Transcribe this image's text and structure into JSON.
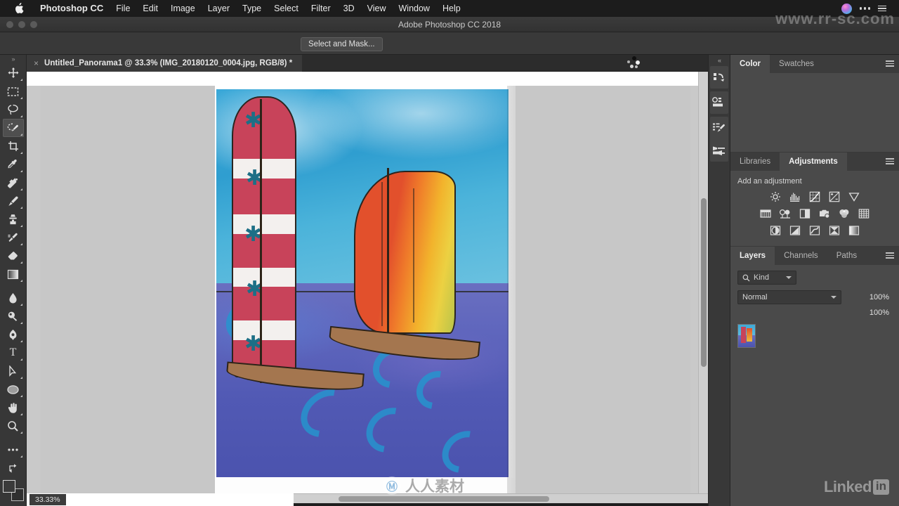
{
  "mac_menubar": {
    "apple_icon": "apple-logo",
    "items": [
      {
        "label": "Photoshop CC",
        "bold": true
      },
      {
        "label": "File",
        "bold": false
      },
      {
        "label": "Edit",
        "bold": false
      },
      {
        "label": "Image",
        "bold": false
      },
      {
        "label": "Layer",
        "bold": false
      },
      {
        "label": "Type",
        "bold": false
      },
      {
        "label": "Select",
        "bold": false
      },
      {
        "label": "Filter",
        "bold": false
      },
      {
        "label": "3D",
        "bold": false
      },
      {
        "label": "View",
        "bold": false
      },
      {
        "label": "Window",
        "bold": false
      },
      {
        "label": "Help",
        "bold": false
      }
    ],
    "right_icons": [
      "siri-icon",
      "control-center-icon",
      "notification-list-icon"
    ]
  },
  "window": {
    "title": "Adobe Photoshop CC 2018"
  },
  "options_bar": {
    "select_and_mask_label": "Select and Mask..."
  },
  "tool_panel": {
    "collapse_glyph": "»",
    "tools": [
      {
        "name": "move-tool",
        "active": false
      },
      {
        "name": "rectangular-marquee-tool",
        "active": false
      },
      {
        "name": "lasso-tool",
        "active": false
      },
      {
        "name": "quick-selection-tool",
        "active": true
      },
      {
        "name": "crop-tool",
        "active": false
      },
      {
        "name": "eyedropper-tool",
        "active": false
      },
      {
        "name": "spot-healing-brush-tool",
        "active": false
      },
      {
        "name": "brush-tool",
        "active": false
      },
      {
        "name": "clone-stamp-tool",
        "active": false
      },
      {
        "name": "history-brush-tool",
        "active": false
      },
      {
        "name": "eraser-tool",
        "active": false
      },
      {
        "name": "gradient-tool",
        "active": false
      },
      {
        "name": "blur-tool",
        "active": false
      },
      {
        "name": "dodge-tool",
        "active": false
      },
      {
        "name": "pen-tool",
        "active": false
      },
      {
        "name": "horizontal-type-tool",
        "active": false
      },
      {
        "name": "path-selection-tool",
        "active": false
      },
      {
        "name": "ellipse-tool",
        "active": false
      },
      {
        "name": "hand-tool",
        "active": false
      },
      {
        "name": "zoom-tool",
        "active": false
      },
      {
        "name": "edit-toolbar-tool",
        "active": false
      },
      {
        "name": "quick-mask-toggle",
        "active": false
      }
    ],
    "type_tool_glyph": "T"
  },
  "document_tab": {
    "close_glyph": "×",
    "title": "Untitled_Panorama1 @ 33.3% (IMG_20180120_0004.jpg, RGB/8) *"
  },
  "status_bar": {
    "zoom_level": "33.33%"
  },
  "icon_dock": {
    "collapse_glyph": "«",
    "buttons": [
      "history-panel-icon",
      "properties-panel-icon",
      "brush-settings-icon",
      "brush-presets-icon"
    ]
  },
  "color_panel": {
    "tabs": [
      {
        "label": "Color",
        "active": true
      },
      {
        "label": "Swatches",
        "active": false
      }
    ],
    "menu_icon": "panel-menu-icon"
  },
  "adjustments_panel": {
    "tabs": [
      {
        "label": "Libraries",
        "active": false
      },
      {
        "label": "Adjustments",
        "active": true
      }
    ],
    "menu_icon": "panel-menu-icon",
    "heading": "Add an adjustment",
    "rows": [
      [
        "brightness-contrast-icon",
        "levels-icon",
        "curves-icon",
        "exposure-icon",
        "vibrance-icon"
      ],
      [
        "hue-saturation-icon",
        "color-balance-icon",
        "black-and-white-icon",
        "photo-filter-icon",
        "channel-mixer-icon",
        "color-lookup-icon"
      ],
      [
        "invert-icon",
        "posterize-icon",
        "threshold-icon",
        "gradient-map-icon",
        "selective-color-icon"
      ]
    ]
  },
  "layers_panel": {
    "tabs": [
      {
        "label": "Layers",
        "active": true
      },
      {
        "label": "Channels",
        "active": false
      },
      {
        "label": "Paths",
        "active": false
      }
    ],
    "menu_icon": "panel-menu-icon",
    "filter_icon": "search-icon",
    "filter_kind": "Kind",
    "blend_mode": "Normal",
    "opacity": "100%",
    "fill": "100%",
    "layers": [
      {
        "thumbnail": "sailboat-watercolor-thumbnail"
      }
    ]
  },
  "watermarks": {
    "site_url": "www.rr-sc.com",
    "linkedin_text": "Linked",
    "linkedin_badge": "in",
    "center_logo_glyph": "Ⓜ",
    "center_text": "人人素材"
  },
  "canvas": {
    "artwork_name": "watercolor-sailboats-painting",
    "background_color": "#c7c7c7"
  }
}
